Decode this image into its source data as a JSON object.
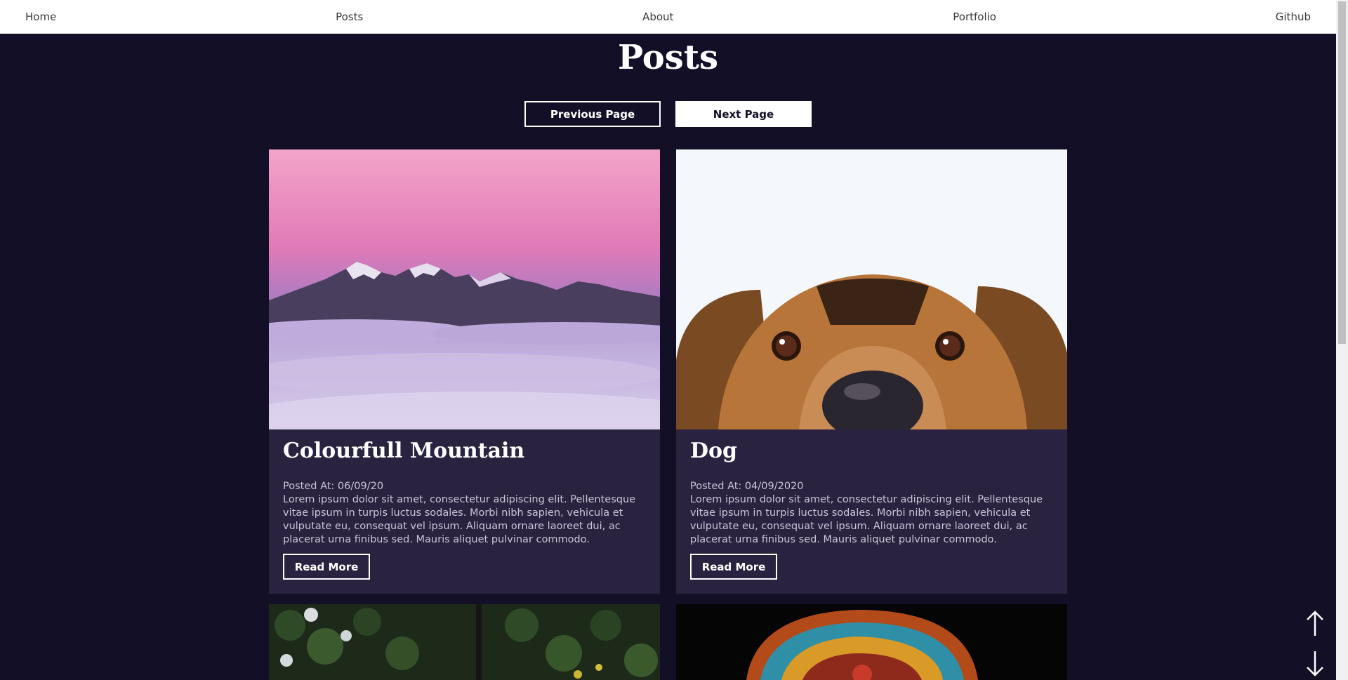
{
  "nav": {
    "items": [
      {
        "label": "Home"
      },
      {
        "label": "Posts"
      },
      {
        "label": "About"
      },
      {
        "label": "Portfolio"
      },
      {
        "label": "Github"
      }
    ]
  },
  "header": {
    "title": "Posts",
    "prev_label": "Previous Page",
    "next_label": "Next Page"
  },
  "posts": [
    {
      "title": "Colourfull Mountain",
      "date": "Posted At: 06/09/20",
      "excerpt": "Lorem ipsum dolor sit amet, consectetur adipiscing elit. Pellentesque vitae ipsum in turpis luctus sodales. Morbi nibh sapien, vehicula et vulputate eu, consequat vel ipsum. Aliquam ornare laoreet dui, ac placerat urna finibus sed. Mauris aliquet pulvinar commodo.",
      "button": "Read More"
    },
    {
      "title": "Dog",
      "date": "Posted At: 04/09/2020",
      "excerpt": "Lorem ipsum dolor sit amet, consectetur adipiscing elit. Pellentesque vitae ipsum in turpis luctus sodales. Morbi nibh sapien, vehicula et vulputate eu, consequat vel ipsum. Aliquam ornare laoreet dui, ac placerat urna finibus sed. Mauris aliquet pulvinar commodo.",
      "button": "Read More"
    }
  ],
  "icons": {
    "scroll_up": "arrow-up-icon",
    "scroll_down": "arrow-down-icon"
  },
  "colors": {
    "background": "#120f27",
    "card": "#2a2340",
    "nav": "#ffffff"
  }
}
